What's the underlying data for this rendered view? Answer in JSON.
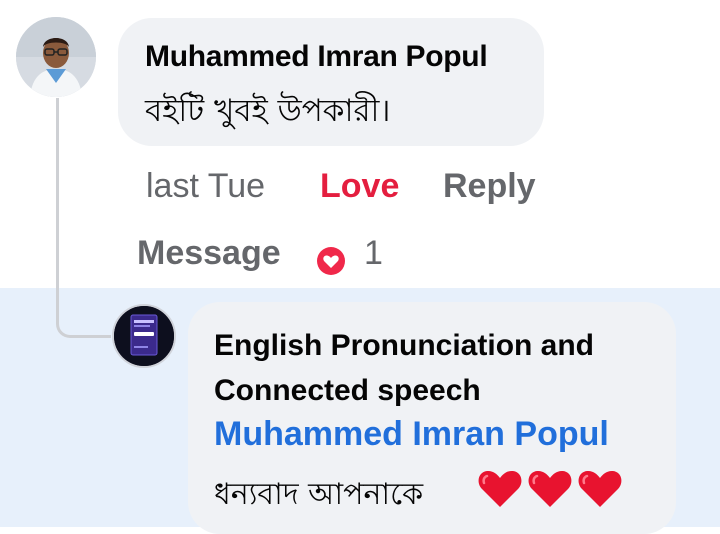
{
  "comment": {
    "author": "Muhammed Imran Popul",
    "text": "বইটি খুবই উপকারী।",
    "time": "last Tue",
    "love_label": "Love",
    "reply_label": "Reply",
    "message_label": "Message",
    "reaction_icon": "heart-reaction-icon",
    "reaction_count": "1"
  },
  "reply": {
    "author": "English Pronunciation and Connected speech",
    "mention": "Muhammed Imran Popul",
    "text": "ধন্যবাদ আপনাকে",
    "emoji_icons": [
      "red-heart-icon",
      "red-heart-icon",
      "red-heart-icon"
    ]
  },
  "colors": {
    "love": "#e41e3f",
    "mention": "#216fdb",
    "reply_highlight": "#e7f0fb",
    "bubble": "#f0f2f5",
    "muted_text": "#65676b"
  }
}
